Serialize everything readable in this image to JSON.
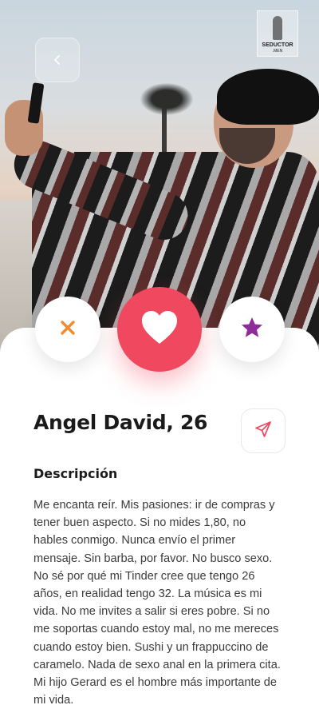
{
  "header": {
    "logo_text": "SEDUCTOR",
    "logo_subtext": ".MEN",
    "back_icon": "chevron-left-icon"
  },
  "actions": {
    "dislike_icon": "close-icon",
    "like_icon": "heart-icon",
    "superlike_icon": "star-icon",
    "colors": {
      "dislike": "#f28a2e",
      "like": "#f0485f",
      "superlike": "#8e2c9a",
      "send": "#f0485f"
    }
  },
  "profile": {
    "name_age": "Angel David, 26",
    "send_icon": "send-icon",
    "description_title": "Descripción",
    "description": "Me encanta reír. Mis pasiones: ir de compras y tener buen aspecto. Si no mides 1,80, no hables conmigo. Nunca envío el primer mensaje. Sin barba, por favor. No busco sexo. No sé por qué mi Tinder cree que tengo 26 años, en realidad tengo 32. La música es mi vida. No me invites a salir si eres pobre. Si no me soportas cuando estoy mal, no me mereces cuando estoy bien. Sushi y un frappuccino de caramelo. Nada de sexo anal en la primera cita. Mi hijo Gerard es el hombre más importante de mi vida."
  }
}
